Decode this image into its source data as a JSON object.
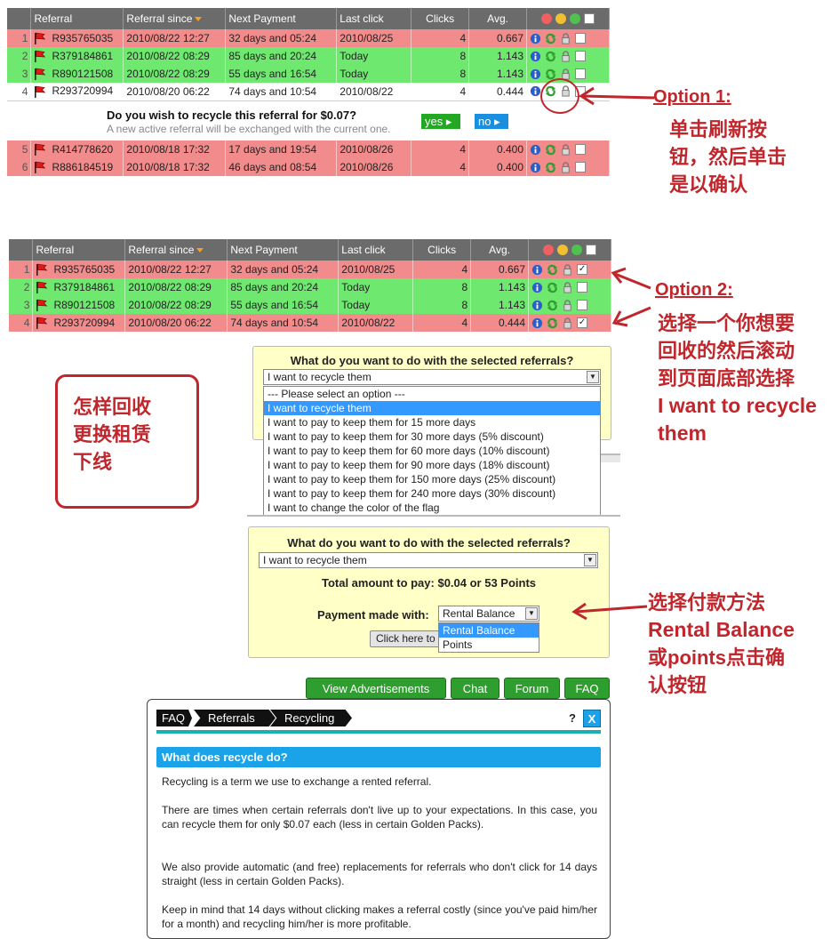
{
  "table_headers": [
    "Referral",
    "Referral since",
    "Next Payment",
    "Last click",
    "Clicks",
    "Avg."
  ],
  "table1_rows": [
    {
      "n": "1",
      "id": "R935765035",
      "since": "2010/08/22 12:27",
      "next": "32 days and 05:24",
      "last": "2010/08/25",
      "clicks": "4",
      "avg": "0.667",
      "color": "red"
    },
    {
      "n": "2",
      "id": "R379184861",
      "since": "2010/08/22 08:29",
      "next": "85 days and 20:24",
      "last": "Today",
      "clicks": "8",
      "avg": "1.143",
      "color": "green"
    },
    {
      "n": "3",
      "id": "R890121508",
      "since": "2010/08/22 08:29",
      "next": "55 days and 16:54",
      "last": "Today",
      "clicks": "8",
      "avg": "1.143",
      "color": "green"
    },
    {
      "n": "4",
      "id": "R293720994",
      "since": "2010/08/20 06:22",
      "next": "74 days and 10:54",
      "last": "2010/08/22",
      "clicks": "4",
      "avg": "0.444",
      "color": "white"
    }
  ],
  "table1_rows_after": [
    {
      "n": "5",
      "id": "R414778620",
      "since": "2010/08/18 17:32",
      "next": "17 days and 19:54",
      "last": "2010/08/26",
      "clicks": "4",
      "avg": "0.400",
      "color": "red"
    },
    {
      "n": "6",
      "id": "R886184519",
      "since": "2010/08/18 17:32",
      "next": "46 days and 08:54",
      "last": "2010/08/26",
      "clicks": "4",
      "avg": "0.400",
      "color": "red"
    }
  ],
  "recycle_prompt": {
    "question": "Do you wish to recycle this referral for $0.07?",
    "note": "A new active referral will be exchanged with the current one.",
    "yes": "yes ▸",
    "no": "no ▸"
  },
  "table2_rows": [
    {
      "n": "1",
      "id": "R935765035",
      "since": "2010/08/22 12:27",
      "next": "32 days and 05:24",
      "last": "2010/08/25",
      "clicks": "4",
      "avg": "0.667",
      "color": "red",
      "checked": true
    },
    {
      "n": "2",
      "id": "R379184861",
      "since": "2010/08/22 08:29",
      "next": "85 days and 20:24",
      "last": "Today",
      "clicks": "8",
      "avg": "1.143",
      "color": "green",
      "checked": false
    },
    {
      "n": "3",
      "id": "R890121508",
      "since": "2010/08/22 08:29",
      "next": "55 days and 16:54",
      "last": "Today",
      "clicks": "8",
      "avg": "1.143",
      "color": "green",
      "checked": false
    },
    {
      "n": "4",
      "id": "R293720994",
      "since": "2010/08/20 06:22",
      "next": "74 days and 10:54",
      "last": "2010/08/22",
      "clicks": "4",
      "avg": "0.444",
      "color": "red",
      "checked": true
    }
  ],
  "annotations": {
    "opt1": "Option 1:",
    "opt1_text": [
      "单击刷新按",
      "钮，然后单击",
      "是以确认"
    ],
    "opt2": "Option 2:",
    "opt2_text": [
      "选择一个你想要",
      "回收的然后滚动",
      "到页面底部选择",
      "I want to recycle",
      "them"
    ],
    "box_text": [
      "怎样回收",
      "更换租赁",
      "下线"
    ],
    "pay_text": [
      "选择付款方法",
      "Rental Balance",
      "或points点击确",
      "认按钮"
    ]
  },
  "action_panel": {
    "title": "What do you want to do with the selected referrals?",
    "selected": "I want to recycle them",
    "options": [
      "--- Please select an option ---",
      "I want to recycle them",
      "I want to pay to keep them for 15 more days",
      "I want to pay to keep them for 30 more days (5% discount)",
      "I want to pay to keep them for 60 more days (10% discount)",
      "I want to pay to keep them for 90 more days (18% discount)",
      "I want to pay to keep them for 150 more days (25% discount)",
      "I want to pay to keep them for 240 more days (30% discount)",
      "I want to change the color of the flag"
    ]
  },
  "pay_panel": {
    "title": "What do you want to do with the selected referrals?",
    "selected": "I want to recycle them",
    "total": "Total amount to pay: $0.04 or 53 Points",
    "payment_label": "Payment made with:",
    "payment_selected": "Rental Balance",
    "payment_options": [
      "Rental Balance",
      "Points"
    ],
    "button": "Click here to"
  },
  "nav_buttons": [
    "View Advertisements",
    "Chat",
    "Forum",
    "FAQ"
  ],
  "faq": {
    "crumbs": [
      "FAQ",
      "Referrals",
      "Recycling"
    ],
    "help": "?",
    "close": "X",
    "heading": "What does recycle do?",
    "paragraphs": [
      "Recycling is a term we use to exchange a rented referral.",
      "There are times when certain referrals don't live up to your expectations. In this case, you can recycle them for only $0.07 each (less in certain Golden Packs).",
      "We also provide automatic (and free) replacements for referrals who don't click for 14 days straight (less in certain Golden Packs).",
      "Keep in mind that 14 days without clicking makes a referral costly (since you've paid him/her for a month) and recycling him/her is more profitable."
    ]
  },
  "colors": {
    "red_row": "#f28b8b",
    "green_row": "#6fe86f",
    "annotation": "#c0262c",
    "faq_heading": "#1aa3e8"
  }
}
